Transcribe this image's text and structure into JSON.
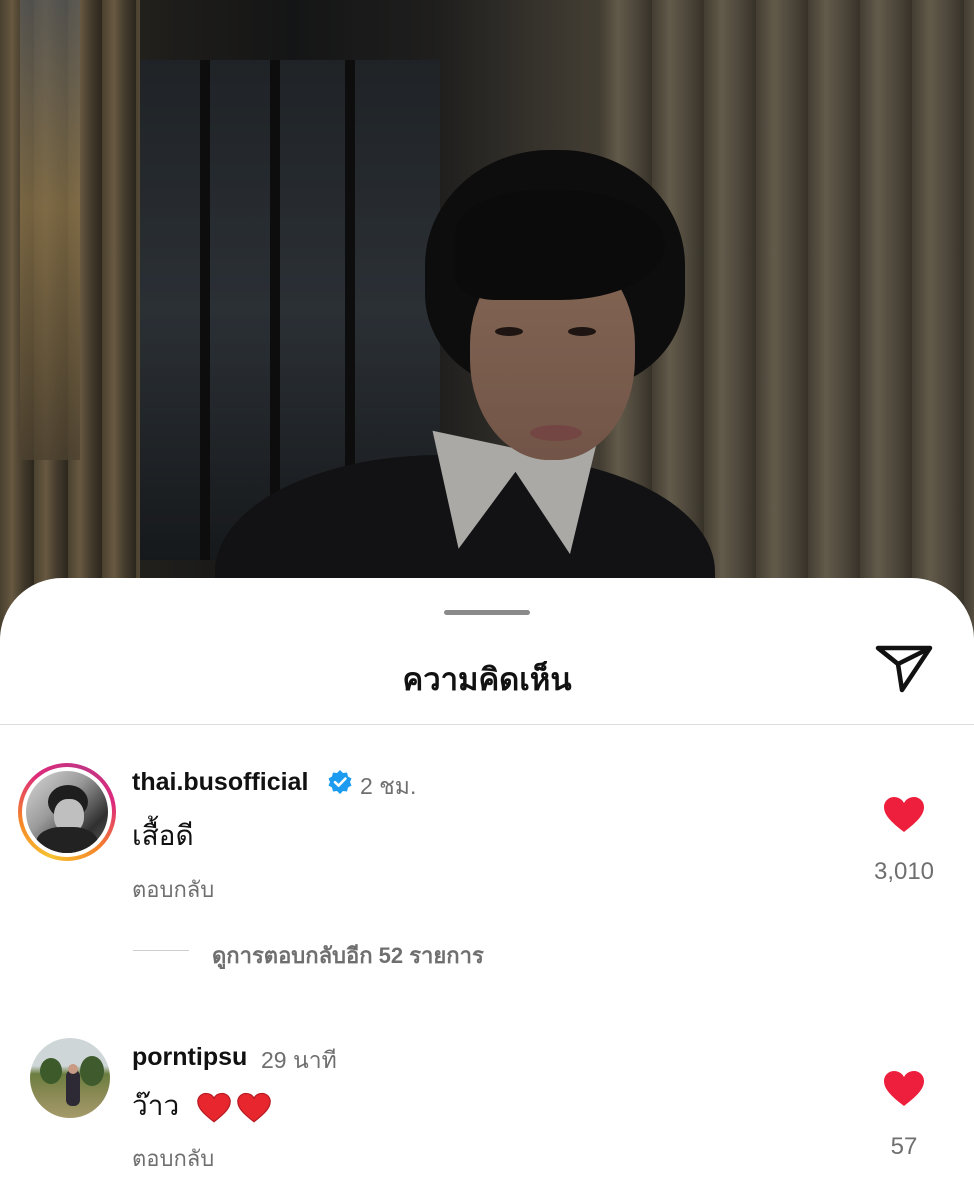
{
  "sheet": {
    "title": "ความคิดเห็น"
  },
  "comments": [
    {
      "username": "thai.busofficial",
      "verified": true,
      "time": "2 ชม.",
      "text": "เสื้อดี",
      "reply_label": "ตอบกลับ",
      "like_count": "3,010",
      "view_replies": "ดูการตอบกลับอีก 52 รายการ",
      "has_story_ring": true
    },
    {
      "username": "porntipsu",
      "verified": false,
      "time": "29 นาที",
      "text": "ว๊าว",
      "text_emoji": [
        "red-heart",
        "red-heart"
      ],
      "reply_label": "ตอบกลับ",
      "like_count": "57",
      "has_story_ring": false
    }
  ],
  "colors": {
    "like_red": "#ed1f3c",
    "verified_blue": "#1d9bf0",
    "secondary_text": "#6f6f6f"
  },
  "icons": {
    "share": "paper-plane-icon",
    "like": "heart-icon",
    "verified": "verified-badge-icon"
  }
}
